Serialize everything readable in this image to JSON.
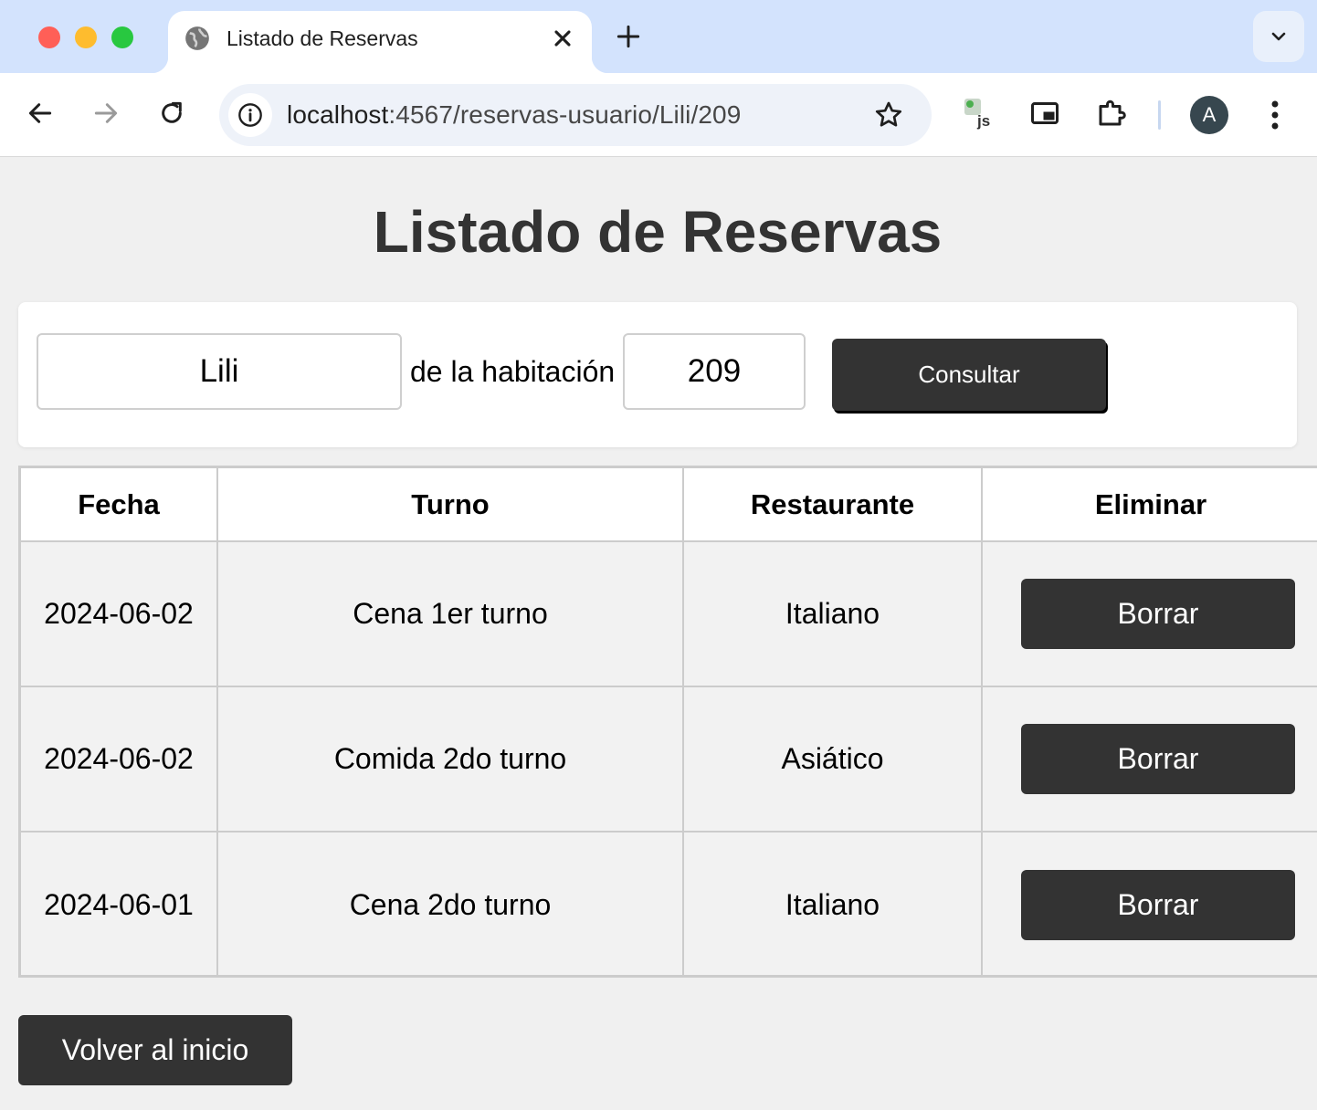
{
  "browser": {
    "tab_title": "Listado de Reservas",
    "url_host": "localhost",
    "url_path": ":4567/reservas-usuario/Lili/209",
    "profile_initial": "A"
  },
  "page": {
    "title": "Listado de Reservas"
  },
  "form": {
    "user_value": "Lili",
    "label": "de la habitación",
    "room_value": "209",
    "submit_label": "Consultar"
  },
  "table": {
    "headers": [
      "Fecha",
      "Turno",
      "Restaurante",
      "Eliminar"
    ],
    "rows": [
      {
        "fecha": "2024-06-02",
        "turno": "Cena 1er turno",
        "restaurante": "Italiano",
        "accion": "Borrar"
      },
      {
        "fecha": "2024-06-02",
        "turno": "Comida 2do turno",
        "restaurante": "Asiático",
        "accion": "Borrar"
      },
      {
        "fecha": "2024-06-01",
        "turno": "Cena 2do turno",
        "restaurante": "Italiano",
        "accion": "Borrar"
      }
    ]
  },
  "footer": {
    "back_label": "Volver al inicio"
  },
  "colors": {
    "button_bg": "#333333",
    "title_color": "#333333",
    "page_bg": "#f0f0f0",
    "chrome_tabstrip": "#d3e3fd"
  },
  "icons": [
    "globe-icon",
    "close-icon",
    "plus-icon",
    "chevron-down-icon",
    "back-arrow-icon",
    "forward-arrow-icon",
    "reload-icon",
    "info-icon",
    "star-icon",
    "js-extension-icon",
    "picture-in-picture-icon",
    "puzzle-icon",
    "more-vert-icon"
  ]
}
